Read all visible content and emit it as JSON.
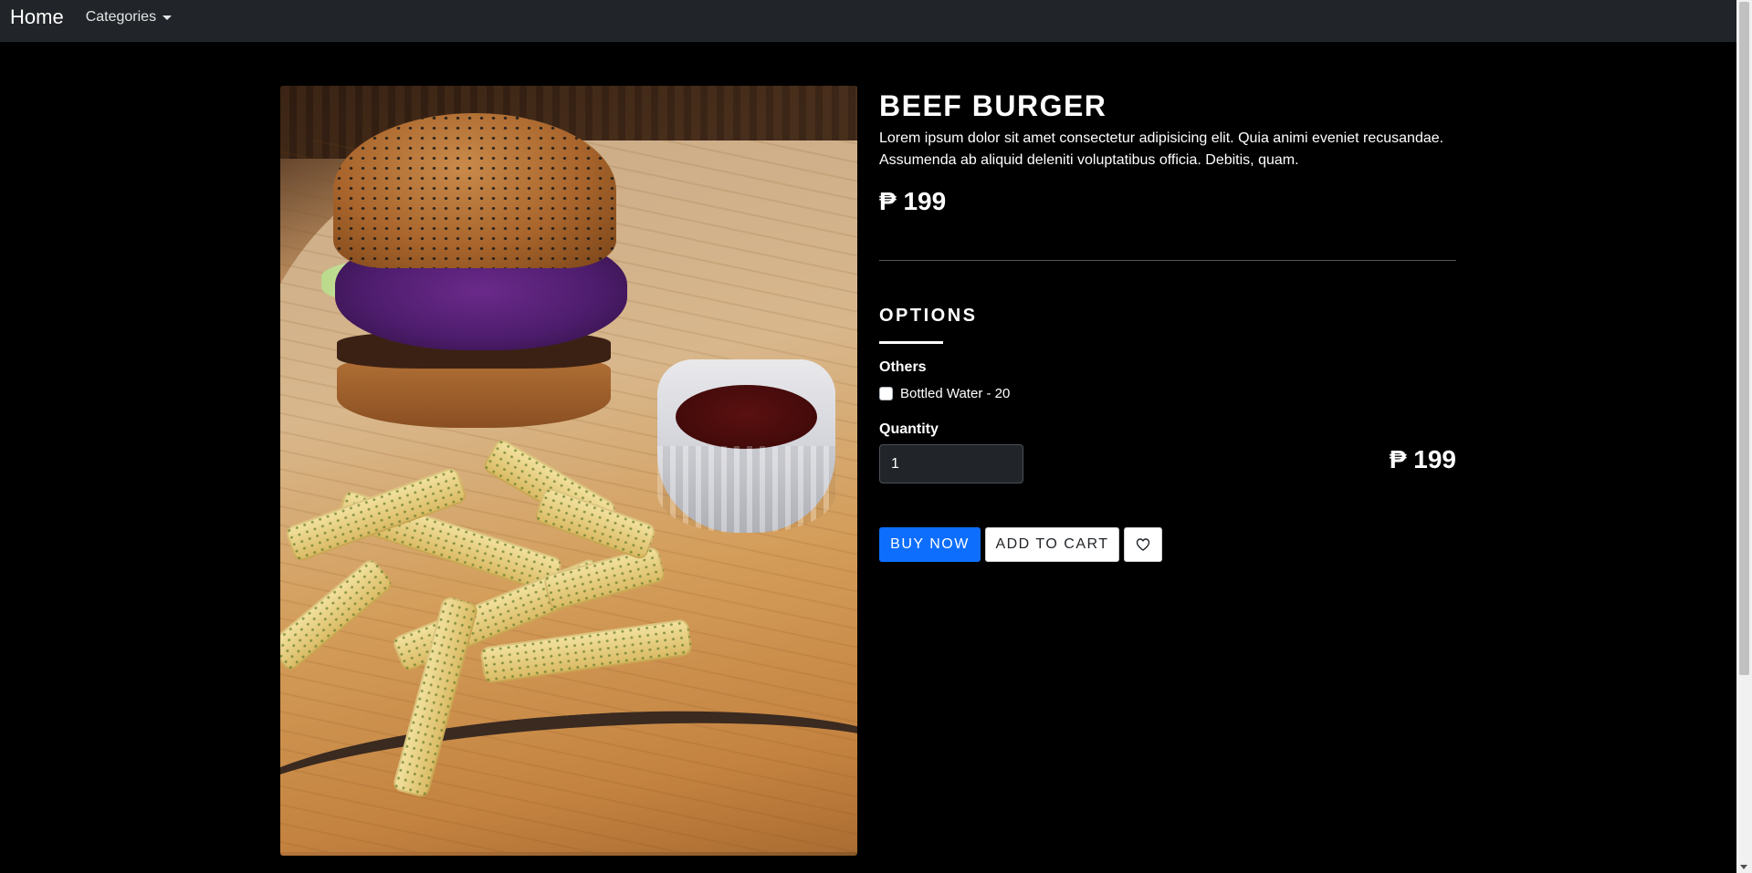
{
  "navbar": {
    "brand": "Home",
    "categories_label": "Categories"
  },
  "product": {
    "title": "BEEF BURGER",
    "description": "Lorem ipsum dolor sit amet consectetur adipisicing elit. Quia animi eveniet recusandae. Assumenda ab aliquid deleniti voluptatibus officia. Debitis, quam.",
    "price": "₱ 199",
    "image_icon": "beef-burger-with-fries-photo"
  },
  "options": {
    "title": "OPTIONS",
    "group_label": "Others",
    "items": [
      {
        "label": "Bottled Water - 20",
        "checked": false
      }
    ]
  },
  "quantity": {
    "label": "Quantity",
    "value": "1"
  },
  "total_price": "₱ 199",
  "actions": {
    "buy_now": "BUY NOW",
    "add_to_cart": "ADD TO CART",
    "wishlist_icon": "heart-icon"
  },
  "colors": {
    "navbar_bg": "#212529",
    "page_bg": "#000000",
    "primary": "#0d6efd"
  }
}
